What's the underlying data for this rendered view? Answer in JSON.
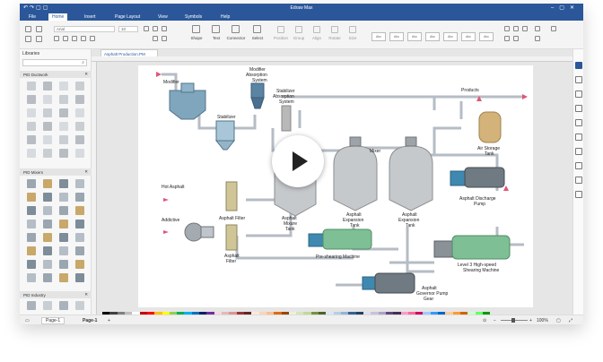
{
  "app": {
    "title": "Edraw Max"
  },
  "menu": [
    "File",
    "Home",
    "Insert",
    "Page Layout",
    "View",
    "Symbols",
    "Help"
  ],
  "menu_active": "Home",
  "ribbon": {
    "font_name": "Arial",
    "font_size": "10",
    "tools": [
      "Shape",
      "Text",
      "Connector",
      "Select"
    ],
    "arrange": [
      "Position",
      "Group",
      "Align",
      "Rotate",
      "Size"
    ],
    "styles": [
      "Abc",
      "Abc",
      "Abc",
      "Abc",
      "Abc",
      "Abc",
      "Abc"
    ]
  },
  "sidebar": {
    "title": "Libraries",
    "sections": [
      "PID Ductwork",
      "PID Mixers",
      "PID Industry"
    ]
  },
  "document_tab": "Asphalt Production.PM",
  "diagram_labels": {
    "modifier": "Modifier",
    "modifier_absorption": [
      "Modifier",
      "Absorption",
      "System"
    ],
    "stabilizer_absorption": [
      "Stabilizer",
      "Absorption",
      "System"
    ],
    "stabilizer": "Stabilizer",
    "products": "Products",
    "air_storage": [
      "Air Storage",
      "Tank"
    ],
    "mixer": "Mixer",
    "hot_asphalt": "Hot Asphalt",
    "asphalt_filter_1": "Asphalt Filter",
    "asphalt_mixure_tank": [
      "Asphalt",
      "Mixure",
      "Tank"
    ],
    "asphalt_expansion_tank_1": [
      "Asphalt",
      "Expansion",
      "Tank"
    ],
    "asphalt_expansion_tank_2": [
      "Asphalt",
      "Expansion",
      "Tank"
    ],
    "asphalt_discharge_pump": [
      "Asphalt Discharge",
      "Pump"
    ],
    "addictive": "Addictive",
    "asphalt_filter_2": [
      "Asphalt",
      "Filter"
    ],
    "preshearing": "Pre-shearing Machine",
    "level3": [
      "Level 3 High-speed",
      "Shearing Machine"
    ],
    "governor_pump": [
      "Asphalt",
      "Governor Pump",
      "Gear"
    ]
  },
  "statusbar": {
    "page_selector": "Page-1",
    "page_tab": "Page-1",
    "add_page": "+",
    "zoom": "100%"
  },
  "palette_colors": [
    "#000000",
    "#404040",
    "#7f7f7f",
    "#bfbfbf",
    "#ffffff",
    "#c00000",
    "#ff0000",
    "#ffc000",
    "#ffff00",
    "#92d050",
    "#00b050",
    "#00b0f0",
    "#0070c0",
    "#002060",
    "#7030a0",
    "#f2dcdb",
    "#e6b8b7",
    "#da9694",
    "#963634",
    "#632523",
    "#fde9d9",
    "#fcd5b4",
    "#fabf8f",
    "#e26b0a",
    "#974706",
    "#ebf1de",
    "#d8e4bc",
    "#c4d79b",
    "#76933c",
    "#4f6228",
    "#dce6f1",
    "#b8cce4",
    "#95b3d7",
    "#366092",
    "#244062",
    "#e4dfec",
    "#ccc0da",
    "#b1a0c7",
    "#60497a",
    "#403151",
    "#ff99cc",
    "#ff6699",
    "#cc0066",
    "#99ccff",
    "#3399ff",
    "#0066cc",
    "#ffcc99",
    "#ff9933",
    "#cc6600",
    "#ccffcc",
    "#66ff66",
    "#009900"
  ]
}
